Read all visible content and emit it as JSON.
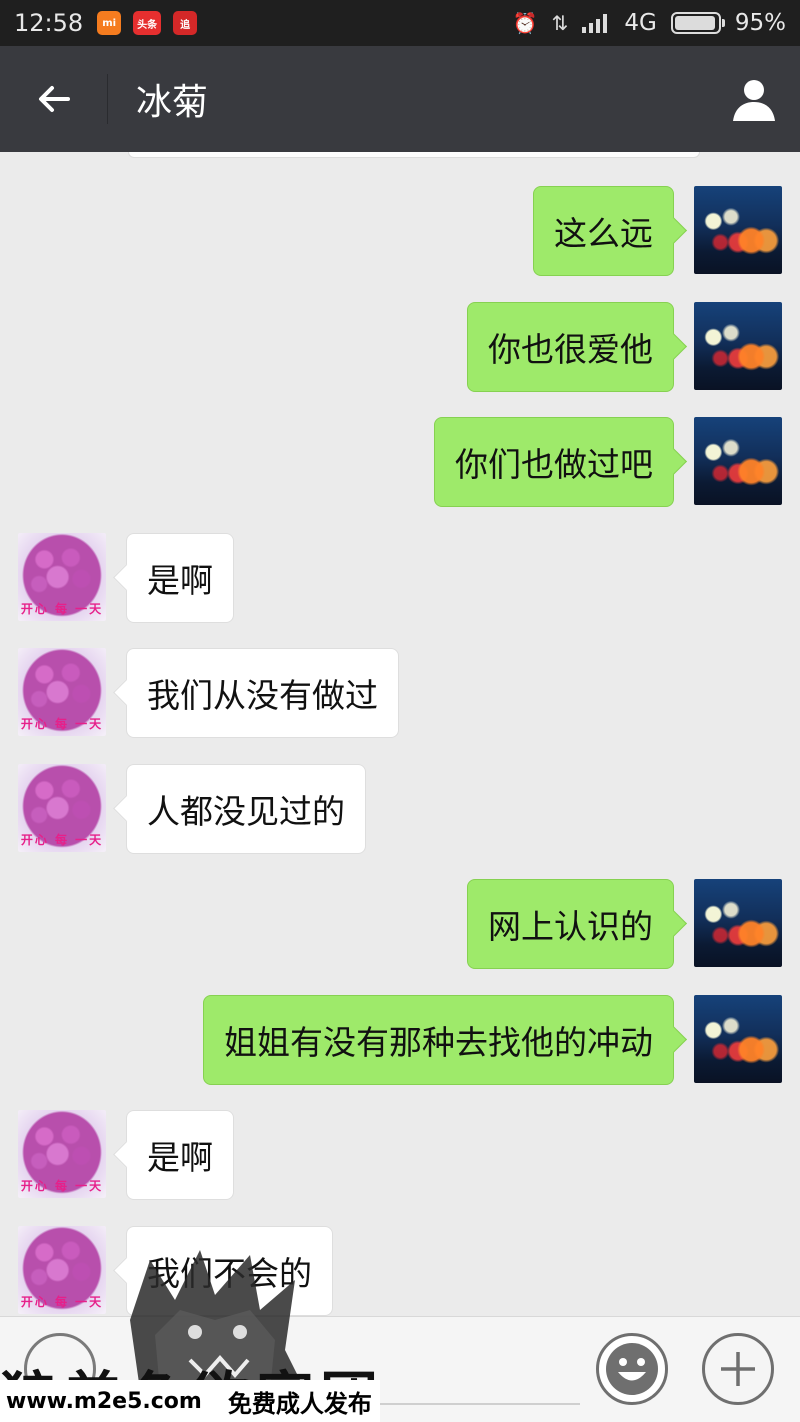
{
  "status_bar": {
    "time": "12:58",
    "notif_mi": "mi",
    "notif_toutiao": "头条",
    "notif_zhui": "追",
    "network": "4G",
    "battery": "95%",
    "battery_level": 0.95
  },
  "header": {
    "title": "冰菊"
  },
  "messages": [
    {
      "from": "self",
      "text": "这么远"
    },
    {
      "from": "self",
      "text": "你也很爱他"
    },
    {
      "from": "self",
      "text": "你们也做过吧"
    },
    {
      "from": "other",
      "text": "是啊"
    },
    {
      "from": "other",
      "text": "我们从没有做过"
    },
    {
      "from": "other",
      "text": "人都没见过的"
    },
    {
      "from": "self",
      "text": "网上认识的"
    },
    {
      "from": "self",
      "text": "姐姐有没有那种去找他的冲动"
    },
    {
      "from": "other",
      "text": "是啊"
    },
    {
      "from": "other",
      "text": "我们不会的"
    }
  ],
  "other_avatar_caption": "开心 每 一天",
  "watermark": {
    "big_text": "狼美色欲富团",
    "url": "www.m2e5.com",
    "slogan": "免费成人发布"
  },
  "colors": {
    "self_bubble": "#9eea6a",
    "other_bubble": "#ffffff",
    "header_bg": "#393a3f",
    "chat_bg": "#ebebeb"
  },
  "icons": {
    "back": "arrow-left-icon",
    "profile": "person-icon",
    "voice": "voice-icon",
    "emoji": "smiley-icon",
    "plus": "plus-icon",
    "alarm": "alarm-icon",
    "data": "data-arrows-icon",
    "signal": "signal-icon",
    "battery": "battery-icon"
  }
}
